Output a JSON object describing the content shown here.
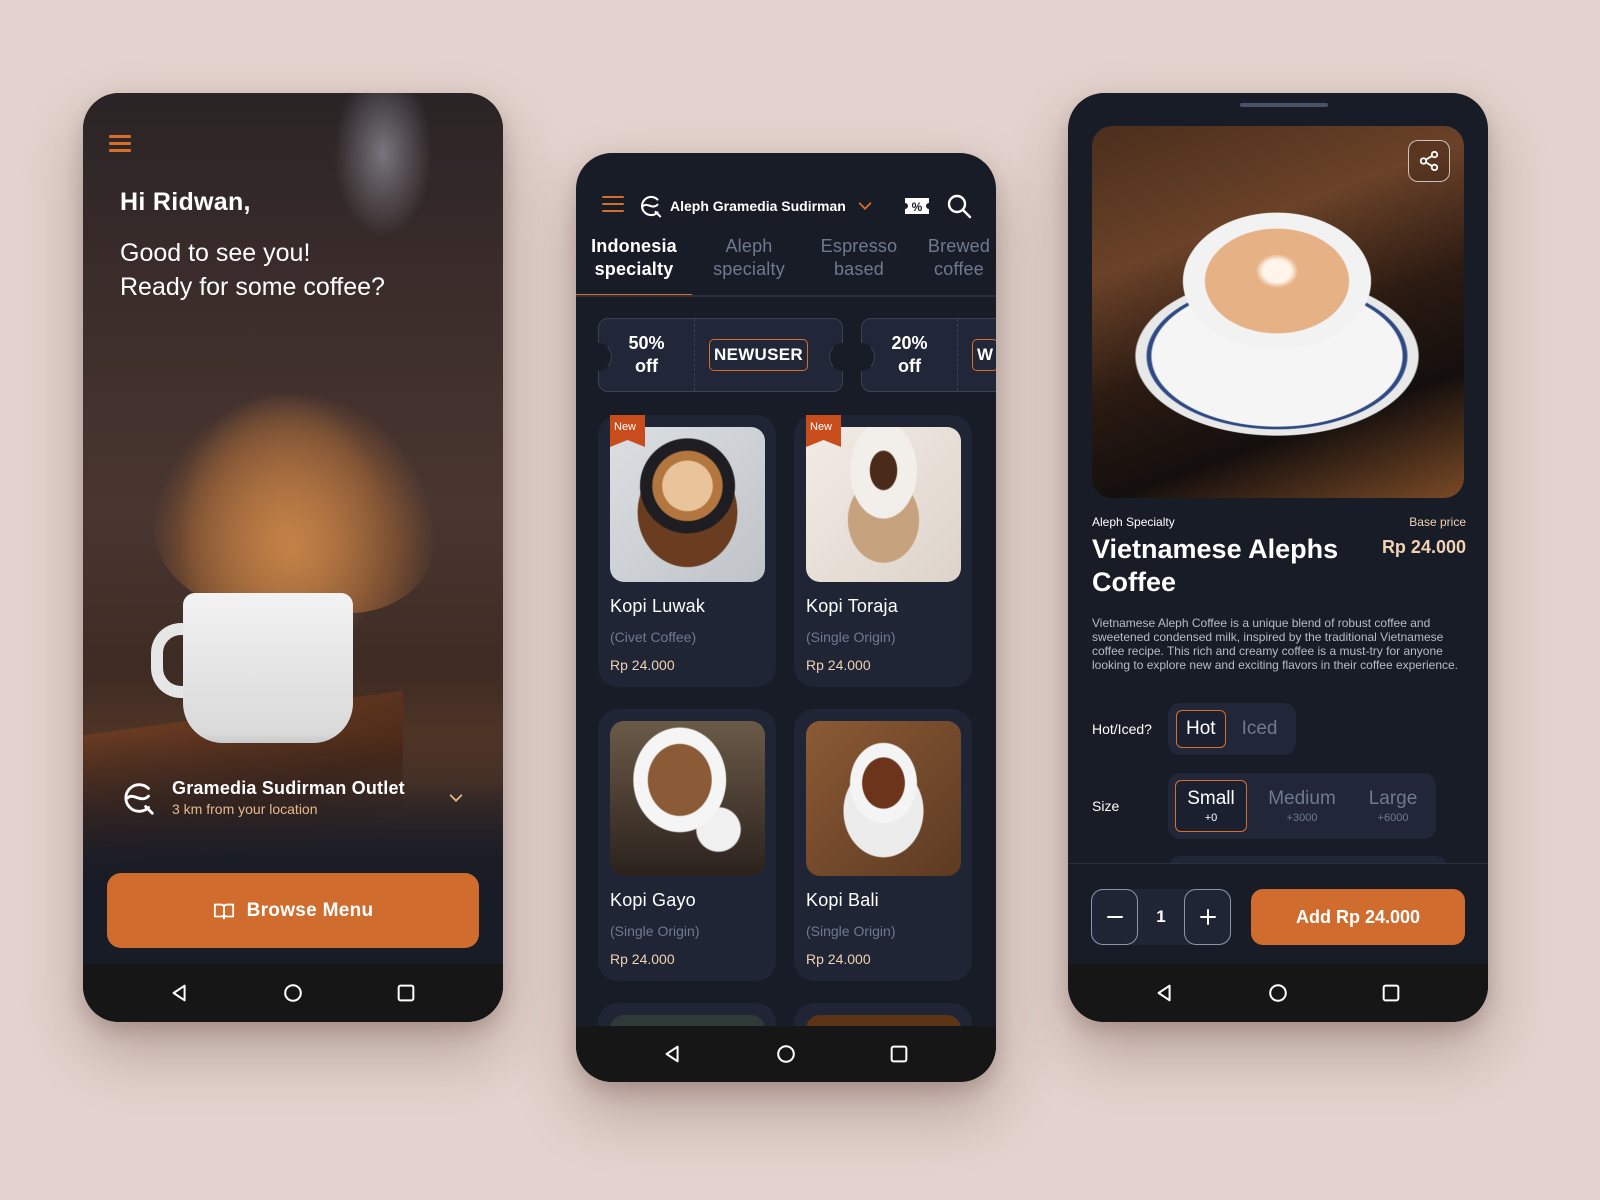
{
  "colors": {
    "accent": "#d06c2e",
    "background": "#e3d2cd",
    "screen_bg": "#181c27",
    "card_bg": "#1f2535",
    "price_text": "#f1d2b2"
  },
  "welcome_screen": {
    "menu_icon": "hamburger-icon",
    "greeting": "Hi Ridwan,",
    "subtitle_line1": "Good to see you!",
    "subtitle_line2": "Ready for some coffee?",
    "outlet": {
      "icon": "aleph-logo-icon",
      "name": "Gramedia Sudirman Outlet",
      "distance": "3 km from your location",
      "dropdown_icon": "chevron-down-icon"
    },
    "browse_button": {
      "icon": "book-open-icon",
      "label": "Browse Menu"
    }
  },
  "menu_screen": {
    "header": {
      "menu_icon": "hamburger-icon",
      "store_name": "Aleph Gramedia Sudirman",
      "promo_icon": "discount-ticket-icon",
      "search_icon": "search-icon"
    },
    "tabs": [
      {
        "line1": "Indonesia",
        "line2": "specialty",
        "active": true
      },
      {
        "line1": "Aleph",
        "line2": "specialty",
        "active": false
      },
      {
        "line1": "Espresso",
        "line2": "based",
        "active": false
      },
      {
        "line1": "Brewed",
        "line2": "coffee",
        "active": false
      }
    ],
    "coupons": [
      {
        "pct": "50%",
        "off": "off",
        "code": "NEWUSER"
      },
      {
        "pct": "20%",
        "off": "off",
        "code": "W"
      }
    ],
    "products": [
      {
        "name": "Kopi Luwak",
        "subtitle": "(Civet Coffee)",
        "price": "Rp 24.000",
        "badge": "New"
      },
      {
        "name": "Kopi Toraja",
        "subtitle": "(Single Origin)",
        "price": "Rp 24.000",
        "badge": "New"
      },
      {
        "name": "Kopi Gayo",
        "subtitle": "(Single Origin)",
        "price": "Rp 24.000",
        "badge": ""
      },
      {
        "name": "Kopi Bali",
        "subtitle": "(Single Origin)",
        "price": "Rp 24.000",
        "badge": ""
      }
    ]
  },
  "detail_screen": {
    "share_icon": "share-icon",
    "category": "Aleph Specialty",
    "base_price_label": "Base price",
    "title": "Vietnamese Alephs Coffee",
    "price": "Rp 24.000",
    "description": "Vietnamese Aleph Coffee is a unique blend of robust coffee and sweetened condensed milk, inspired by the traditional Vietnamese coffee recipe. This rich and creamy coffee is a must-try for anyone looking to explore new and exciting flavors in their coffee experience.",
    "temperature": {
      "label": "Hot/Iced?",
      "options": [
        {
          "label": "Hot",
          "selected": true
        },
        {
          "label": "Iced",
          "selected": false
        }
      ]
    },
    "size": {
      "label": "Size",
      "options": [
        {
          "label": "Small",
          "extra": "+0",
          "selected": true
        },
        {
          "label": "Medium",
          "extra": "+3000",
          "selected": false
        },
        {
          "label": "Large",
          "extra": "+6000",
          "selected": false
        }
      ]
    },
    "quantity": "1",
    "add_button": "Add Rp 24.000"
  },
  "android_nav": {
    "back_icon": "back-triangle-icon",
    "home_icon": "home-circle-icon",
    "recents_icon": "recents-square-icon"
  }
}
